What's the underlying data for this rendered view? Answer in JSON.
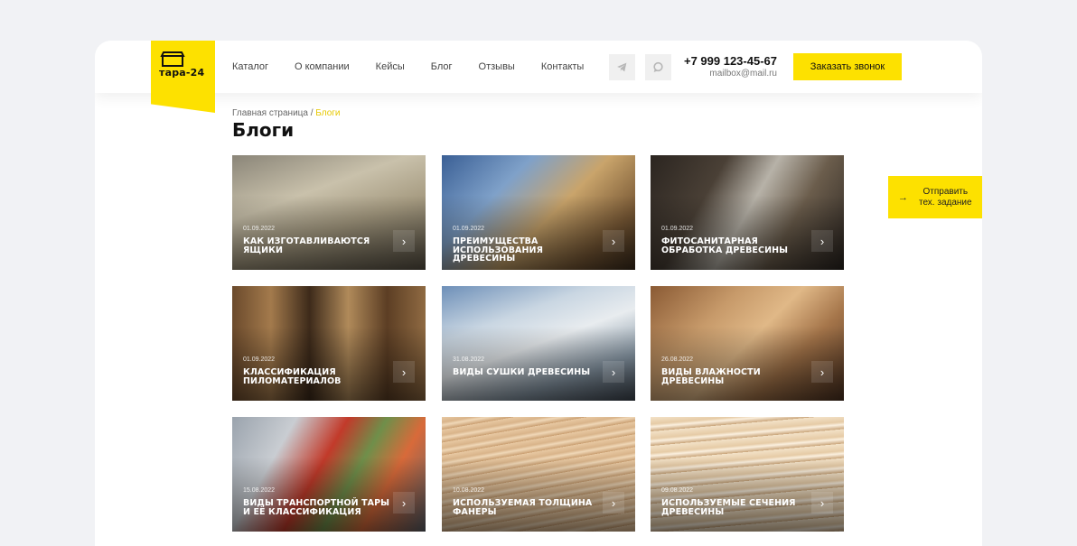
{
  "header": {
    "logo_text": "тара-24",
    "nav": [
      "Каталог",
      "О компании",
      "Кейсы",
      "Блог",
      "Отзывы",
      "Контакты"
    ],
    "phone": "+7 999 123-45-67",
    "email": "mailbox@mail.ru",
    "callback_label": "Заказать звонок"
  },
  "breadcrumb": {
    "home": "Главная страница",
    "separator": " / ",
    "current": "Блоги"
  },
  "page_title": "Блоги",
  "cards": [
    {
      "date": "01.09.2022",
      "title": "КАК ИЗГОТАВЛИВАЮТСЯ ЯЩИКИ"
    },
    {
      "date": "01.09.2022",
      "title": "ПРЕИМУЩЕСТВА ИСПОЛЬЗОВАНИЯ ДРЕВЕСИНЫ"
    },
    {
      "date": "01.09.2022",
      "title": "ФИТОСАНИТАРНАЯ ОБРАБОТКА ДРЕВЕСИНЫ"
    },
    {
      "date": "01.09.2022",
      "title": "КЛАССИФИКАЦИЯ ПИЛОМАТЕРИАЛОВ"
    },
    {
      "date": "31.08.2022",
      "title": "ВИДЫ СУШКИ ДРЕВЕСИНЫ"
    },
    {
      "date": "26.08.2022",
      "title": "ВИДЫ ВЛАЖНОСТИ ДРЕВЕСИНЫ"
    },
    {
      "date": "15.08.2022",
      "title": "ВИДЫ ТРАНСПОРТНОЙ ТАРЫ И ЕЁ КЛАССИФИКАЦИЯ"
    },
    {
      "date": "10.08.2022",
      "title": "ИСПОЛЬЗУЕМАЯ ТОЛЩИНА ФАНЕРЫ"
    },
    {
      "date": "09.08.2022",
      "title": "ИСПОЛЬЗУЕМЫЕ СЕЧЕНИЯ ДРЕВЕСИНЫ"
    }
  ],
  "send_brief": {
    "line1": "Отправить",
    "line2": "тех. задание"
  },
  "colors": {
    "accent": "#fde100",
    "background": "#f1f2f5"
  },
  "icons": {
    "telegram": "telegram-icon",
    "whatsapp": "whatsapp-icon",
    "card_arrow": "chevron-right-icon",
    "send_arrow": "arrow-right-icon"
  }
}
